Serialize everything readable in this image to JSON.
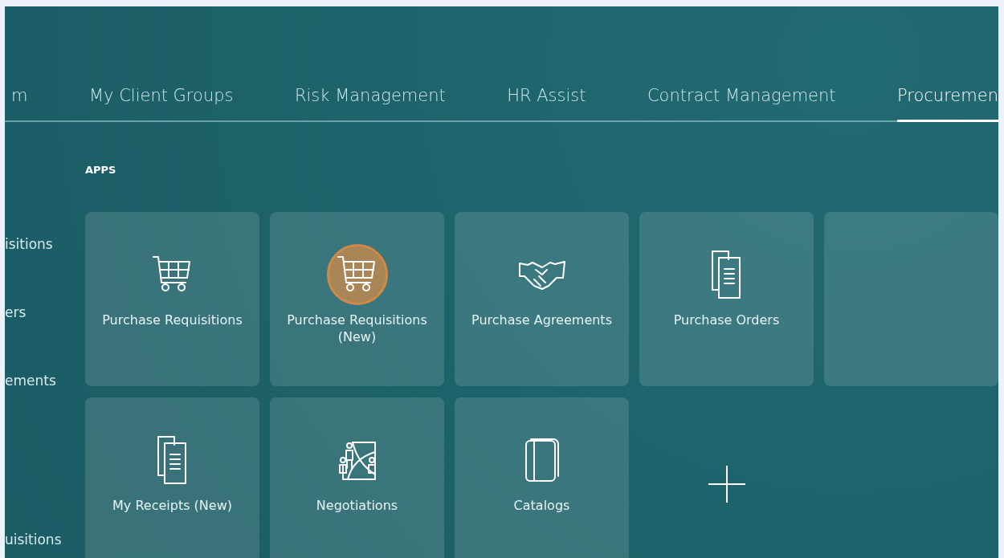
{
  "nav": {
    "tabs": [
      {
        "label": "m",
        "selected": false
      },
      {
        "label": "My Client Groups",
        "selected": false
      },
      {
        "label": "Risk Management",
        "selected": false
      },
      {
        "label": "HR Assist",
        "selected": false
      },
      {
        "label": "Contract Management",
        "selected": false
      },
      {
        "label": "Procuremen",
        "selected": true
      }
    ]
  },
  "sidebar": {
    "items": [
      {
        "label": "isitions"
      },
      {
        "label": "ers"
      },
      {
        "label": "ements"
      },
      {
        "label": "uisitions"
      }
    ]
  },
  "apps": {
    "heading": "APPS",
    "tiles": [
      {
        "kind": "app",
        "label": "Purchase Requisitions",
        "highlighted": false
      },
      {
        "kind": "app",
        "label": "Purchase Requisitions (New)",
        "highlighted": true
      },
      {
        "kind": "app",
        "label": "Purchase Agreements",
        "highlighted": false
      },
      {
        "kind": "app",
        "label": "Purchase Orders",
        "highlighted": false
      },
      {
        "kind": "partial"
      },
      {
        "kind": "app",
        "label": "My Receipts (New)",
        "highlighted": false
      },
      {
        "kind": "app",
        "label": "Negotiations",
        "highlighted": false
      },
      {
        "kind": "app",
        "label": "Catalogs",
        "highlighted": false
      },
      {
        "kind": "add"
      }
    ]
  }
}
